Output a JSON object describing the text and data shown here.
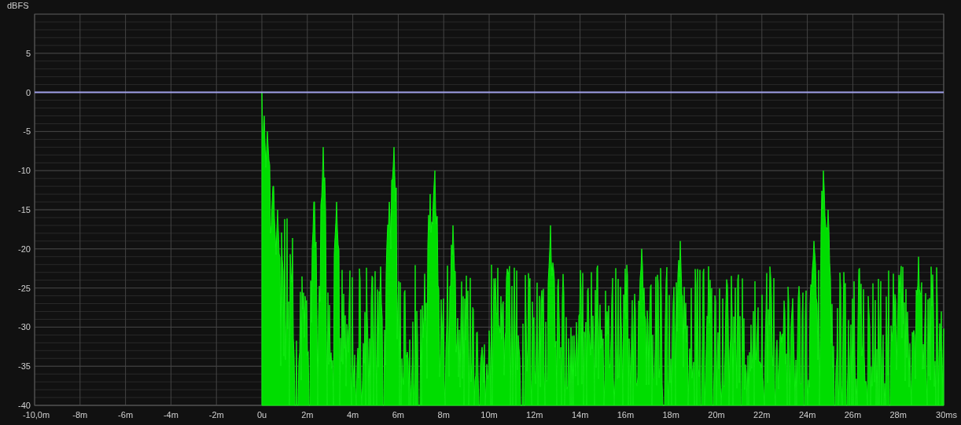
{
  "chart_data": {
    "type": "line",
    "grid": true,
    "ylabel": "dBFS",
    "xlim": [
      -10,
      30
    ],
    "ylim": [
      -40,
      10
    ],
    "xticks": [
      {
        "value": -10,
        "label": "-10,0m"
      },
      {
        "value": -8,
        "label": "-8m"
      },
      {
        "value": -6,
        "label": "-6m"
      },
      {
        "value": -4,
        "label": "-4m"
      },
      {
        "value": -2,
        "label": "-2m"
      },
      {
        "value": 0,
        "label": "0u"
      },
      {
        "value": 2,
        "label": "2m"
      },
      {
        "value": 4,
        "label": "4m"
      },
      {
        "value": 6,
        "label": "6m"
      },
      {
        "value": 8,
        "label": "8m"
      },
      {
        "value": 10,
        "label": "10m"
      },
      {
        "value": 12,
        "label": "12m"
      },
      {
        "value": 14,
        "label": "14m"
      },
      {
        "value": 16,
        "label": "16m"
      },
      {
        "value": 18,
        "label": "18m"
      },
      {
        "value": 20,
        "label": "20m"
      },
      {
        "value": 22,
        "label": "22m"
      },
      {
        "value": 24,
        "label": "24m"
      },
      {
        "value": 26,
        "label": "26m"
      },
      {
        "value": 28,
        "label": "28m"
      },
      {
        "value": 30,
        "label": "30ms"
      }
    ],
    "yticks": [
      {
        "value": 5,
        "label": "5"
      },
      {
        "value": 0,
        "label": "0"
      },
      {
        "value": -5,
        "label": "-5"
      },
      {
        "value": -10,
        "label": "-10"
      },
      {
        "value": -15,
        "label": "-15"
      },
      {
        "value": -20,
        "label": "-20"
      },
      {
        "value": -25,
        "label": "-25"
      },
      {
        "value": -30,
        "label": "-30"
      },
      {
        "value": -35,
        "label": "-35"
      },
      {
        "value": -40,
        "label": "-40"
      }
    ],
    "x": [
      -10,
      30
    ],
    "series": [
      {
        "color": "#a0a0e8",
        "values": [
          0,
          0
        ]
      }
    ]
  }
}
